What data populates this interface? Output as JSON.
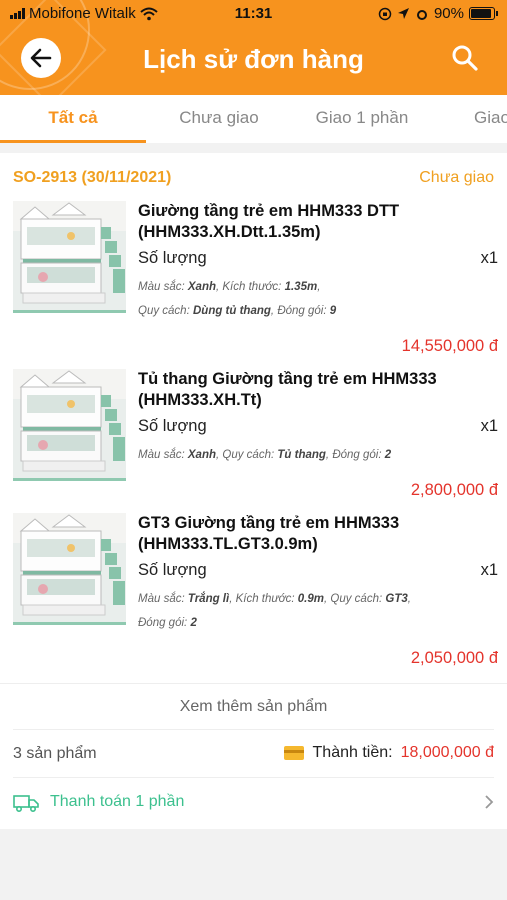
{
  "status_bar": {
    "carrier": "Mobifone Witalk",
    "time": "11:31",
    "battery": "90%",
    "battery_level": 0.9
  },
  "header": {
    "title": "Lịch sử đơn hàng",
    "back_icon": "arrow-left-icon",
    "search_icon": "search-icon"
  },
  "tabs": [
    {
      "label": "Tất cả",
      "active": true
    },
    {
      "label": "Chưa giao",
      "active": false
    },
    {
      "label": "Giao 1 phần",
      "active": false
    },
    {
      "label": "Giao",
      "active": false
    }
  ],
  "order": {
    "id": "SO-2913 (30/11/2021)",
    "status": "Chưa giao",
    "items": [
      {
        "name": "Giường tầng trẻ em HHM333 DTT (HHM333.XH.Dtt.1.35m)",
        "qty_label": "Số lượng",
        "qty": "x1",
        "attrs": [
          {
            "k": "Màu sắc:",
            "v": "Xanh"
          },
          {
            "k": "Kích thước:",
            "v": "1.35m"
          },
          {
            "k": "Quy cách:",
            "v": "Dùng tủ thang"
          },
          {
            "k": "Đóng gói:",
            "v": "9"
          }
        ],
        "price": "14,550,000 đ"
      },
      {
        "name": "Tủ thang Giường tầng trẻ em HHM333 (HHM333.XH.Tt)",
        "qty_label": "Số lượng",
        "qty": "x1",
        "attrs": [
          {
            "k": "Màu sắc:",
            "v": "Xanh"
          },
          {
            "k": "Quy cách:",
            "v": "Tủ thang"
          },
          {
            "k": "Đóng gói:",
            "v": "2"
          }
        ],
        "price": "2,800,000 đ"
      },
      {
        "name": "GT3 Giường tầng trẻ em HHM333 (HHM333.TL.GT3.0.9m)",
        "qty_label": "Số lượng",
        "qty": "x1",
        "attrs": [
          {
            "k": "Màu sắc:",
            "v": "Trắng lì"
          },
          {
            "k": "Kích thước:",
            "v": "0.9m"
          },
          {
            "k": "Quy cách:",
            "v": "GT3"
          },
          {
            "k": "Đóng gói:",
            "v": "2"
          }
        ],
        "price": "2,050,000 đ"
      }
    ],
    "see_more": "Xem thêm sản phẩm",
    "product_count": "3 sản phẩm",
    "total_label": "Thành tiền:",
    "total_value": "18,000,000 đ",
    "payment_status": "Thanh toán 1 phần"
  },
  "colors": {
    "brand": "#f7931e",
    "price": "#e4342c",
    "paid": "#3cc08e"
  }
}
